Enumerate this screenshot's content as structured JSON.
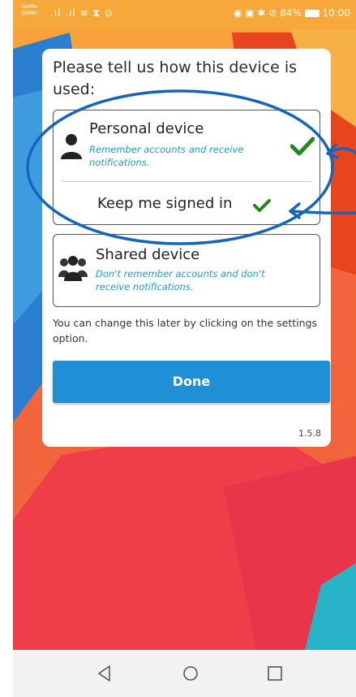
{
  "status_bar": {
    "carrier_line1": "GoMo",
    "carrier_line2": "GoMo",
    "signal_icons": ".ıl .ıl ≋ ⧗ ⊙",
    "battery_percent": "84%",
    "time": "10:00"
  },
  "dialog": {
    "question": "Please tell us how this device is used:",
    "personal": {
      "title": "Personal device",
      "subtitle": "Remember accounts and receive notifications.",
      "selected": true,
      "icon": "person-icon"
    },
    "keep_signed_in": {
      "label": "Keep me signed in",
      "checked": true
    },
    "shared": {
      "title": "Shared device",
      "subtitle": "Don't remember accounts and don't receive notifications.",
      "selected": false,
      "icon": "group-icon"
    },
    "note": "You can change this later by clicking on the settings option.",
    "done_label": "Done",
    "version": "1.5.8"
  },
  "colors": {
    "accent": "#1f8fd6",
    "check": "#1e8a1e",
    "annotation": "#1565b8",
    "subtitle": "#1a9bd0"
  },
  "nav_bar": {
    "icons": [
      "back-icon",
      "home-icon",
      "recents-icon"
    ]
  }
}
